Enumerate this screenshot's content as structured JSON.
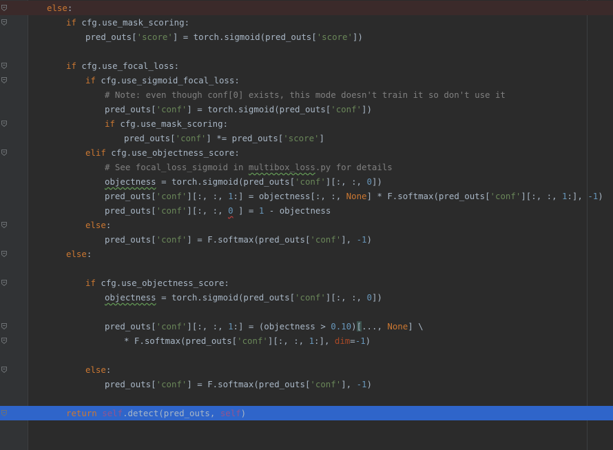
{
  "editor": {
    "lines": [
      {
        "indent": 8,
        "tokens": [
          [
            "kw",
            "else"
          ],
          [
            "",
            ""
          ],
          [
            "p",
            ":"
          ]
        ]
      },
      {
        "indent": 12,
        "tokens": [
          [
            "kw",
            "if"
          ],
          [
            "p",
            " cfg.use_mask_scoring:"
          ]
        ]
      },
      {
        "indent": 16,
        "tokens": [
          [
            "p",
            "pred_outs["
          ],
          [
            "str",
            "'score'"
          ],
          [
            "p",
            "] = torch.sigmoid(pred_outs["
          ],
          [
            "str",
            "'score'"
          ],
          [
            "p",
            "])"
          ]
        ]
      },
      {
        "indent": 0,
        "tokens": []
      },
      {
        "indent": 12,
        "tokens": [
          [
            "kw",
            "if"
          ],
          [
            "p",
            " cfg.use_focal_loss:"
          ]
        ]
      },
      {
        "indent": 16,
        "tokens": [
          [
            "kw",
            "if"
          ],
          [
            "p",
            " cfg.use_sigmoid_focal_loss:"
          ]
        ]
      },
      {
        "indent": 20,
        "tokens": [
          [
            "cmt",
            "# Note: even though conf[0] exists, this mode doesn't train it so don't use it"
          ]
        ]
      },
      {
        "indent": 20,
        "tokens": [
          [
            "p",
            "pred_outs["
          ],
          [
            "str",
            "'conf'"
          ],
          [
            "p",
            "] = torch.sigmoid(pred_outs["
          ],
          [
            "str",
            "'conf'"
          ],
          [
            "p",
            "])"
          ]
        ]
      },
      {
        "indent": 20,
        "tokens": [
          [
            "kw",
            "if"
          ],
          [
            "p",
            " cfg.use_mask_scoring:"
          ]
        ]
      },
      {
        "indent": 24,
        "tokens": [
          [
            "p",
            "pred_outs["
          ],
          [
            "str",
            "'conf'"
          ],
          [
            "p",
            "] *= pred_outs["
          ],
          [
            "str",
            "'score'"
          ],
          [
            "p",
            "]"
          ]
        ]
      },
      {
        "indent": 16,
        "tokens": [
          [
            "kw",
            "elif"
          ],
          [
            "p",
            " cfg.use_objectness_score:"
          ]
        ]
      },
      {
        "indent": 20,
        "tokens": [
          [
            "cmt",
            "# See focal_loss_sigmoid in "
          ],
          [
            "cmtsq",
            "multibox_loss"
          ],
          [
            "cmt",
            ".py for details"
          ]
        ]
      },
      {
        "indent": 20,
        "tokens": [
          [
            "sq",
            "objectness"
          ],
          [
            "p",
            " = torch.sigmoid(pred_outs["
          ],
          [
            "str",
            "'conf'"
          ],
          [
            "p",
            "][:, :, "
          ],
          [
            "num",
            "0"
          ],
          [
            "p",
            "])"
          ]
        ]
      },
      {
        "indent": 20,
        "tokens": [
          [
            "p",
            "pred_outs["
          ],
          [
            "str",
            "'conf'"
          ],
          [
            "p",
            "][:, :, "
          ],
          [
            "num",
            "1"
          ],
          [
            "p",
            ":] = objectness[:, :, "
          ],
          [
            "kw",
            "None"
          ],
          [
            "p",
            "] * F.softmax(pred_outs["
          ],
          [
            "str",
            "'conf'"
          ],
          [
            "p",
            "][:, :, "
          ],
          [
            "num",
            "1"
          ],
          [
            "p",
            ":], "
          ],
          [
            "num",
            "-1"
          ],
          [
            "p",
            ")"
          ]
        ]
      },
      {
        "indent": 20,
        "tokens": [
          [
            "p",
            "pred_outs["
          ],
          [
            "str",
            "'conf'"
          ],
          [
            "p",
            "][:, :, "
          ],
          [
            "numsq",
            "0"
          ],
          [
            "p",
            " ] = "
          ],
          [
            "num",
            "1"
          ],
          [
            "p",
            " - objectness"
          ]
        ]
      },
      {
        "indent": 16,
        "tokens": [
          [
            "kw",
            "else"
          ],
          [
            "p",
            ":"
          ]
        ]
      },
      {
        "indent": 20,
        "tokens": [
          [
            "p",
            "pred_outs["
          ],
          [
            "str",
            "'conf'"
          ],
          [
            "p",
            "] = F.softmax(pred_outs["
          ],
          [
            "str",
            "'conf'"
          ],
          [
            "p",
            "], "
          ],
          [
            "num",
            "-1"
          ],
          [
            "p",
            ")"
          ]
        ]
      },
      {
        "indent": 12,
        "tokens": [
          [
            "kw",
            "else"
          ],
          [
            "p",
            ":"
          ]
        ]
      },
      {
        "indent": 0,
        "tokens": []
      },
      {
        "indent": 16,
        "tokens": [
          [
            "kw",
            "if"
          ],
          [
            "p",
            " cfg.use_objectness_score:"
          ]
        ]
      },
      {
        "indent": 20,
        "tokens": [
          [
            "sq",
            "objectness"
          ],
          [
            "p",
            " = torch.sigmoid(pred_outs["
          ],
          [
            "str",
            "'conf'"
          ],
          [
            "p",
            "][:, :, "
          ],
          [
            "num",
            "0"
          ],
          [
            "p",
            "])"
          ]
        ]
      },
      {
        "indent": 0,
        "tokens": []
      },
      {
        "indent": 20,
        "tokens": [
          [
            "p",
            "pred_outs["
          ],
          [
            "str",
            "'conf'"
          ],
          [
            "p",
            "][:, :, "
          ],
          [
            "num",
            "1"
          ],
          [
            "p",
            ":] = (objectness > "
          ],
          [
            "num",
            "0.10"
          ],
          [
            "p",
            ")"
          ],
          [
            "brk",
            "["
          ],
          [
            "p",
            "..., "
          ],
          [
            "kw",
            "None"
          ],
          [
            "p",
            "] \\"
          ]
        ]
      },
      {
        "indent": 24,
        "tokens": [
          [
            "p",
            "* F.softmax(pred_outs["
          ],
          [
            "str",
            "'conf'"
          ],
          [
            "p",
            "][:, :, "
          ],
          [
            "num",
            "1"
          ],
          [
            "p",
            ":], "
          ],
          [
            "param",
            "dim"
          ],
          [
            "p",
            "="
          ],
          [
            "num",
            "-1"
          ],
          [
            "p",
            ")"
          ]
        ]
      },
      {
        "indent": 0,
        "tokens": []
      },
      {
        "indent": 16,
        "tokens": [
          [
            "kw",
            "else"
          ],
          [
            "p",
            ":"
          ]
        ]
      },
      {
        "indent": 20,
        "tokens": [
          [
            "p",
            "pred_outs["
          ],
          [
            "str",
            "'conf'"
          ],
          [
            "p",
            "] = F.softmax(pred_outs["
          ],
          [
            "str",
            "'conf'"
          ],
          [
            "p",
            "], "
          ],
          [
            "num",
            "-1"
          ],
          [
            "p",
            ")"
          ]
        ]
      },
      {
        "indent": 0,
        "tokens": []
      },
      {
        "indent": 12,
        "tokens": [
          [
            "kw",
            "return"
          ],
          [
            "p",
            " "
          ],
          [
            "self",
            "self"
          ],
          [
            "p",
            ".detect(pred_outs, "
          ],
          [
            "self",
            "self"
          ],
          [
            "p",
            ")"
          ]
        ]
      }
    ],
    "current_line_index": 28,
    "colors": {
      "background": "#2b2b2b",
      "gutter": "#313335",
      "current_line": "#2f65ca",
      "keyword": "#cc7832",
      "string": "#6a8759",
      "number": "#6897bb",
      "comment": "#808080",
      "self": "#94558d",
      "param": "#aa4926",
      "text": "#a9b7c6"
    },
    "fold_markers": [
      0,
      1,
      4,
      5,
      8,
      10,
      15,
      17,
      19,
      22,
      23,
      25,
      28
    ]
  }
}
